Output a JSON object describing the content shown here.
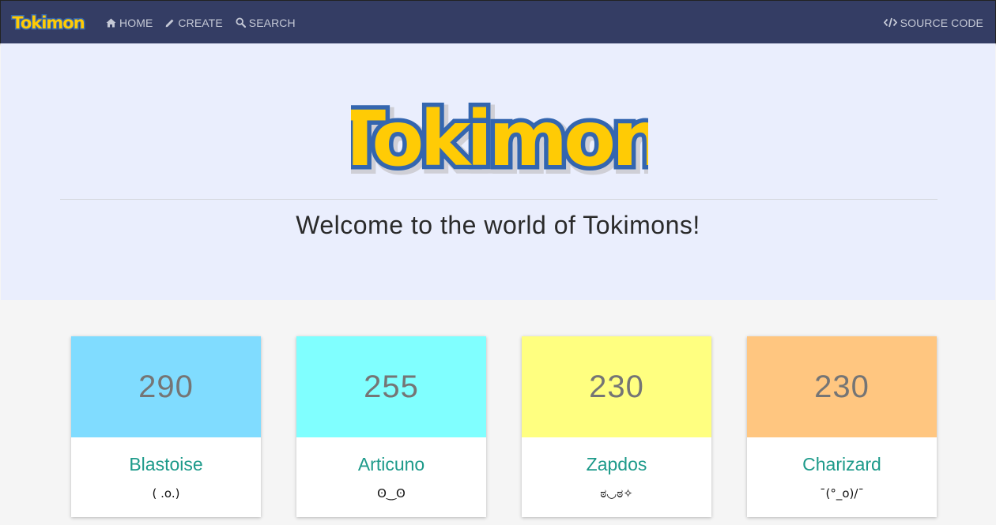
{
  "nav": {
    "logo_text": "Tokimon",
    "links": [
      {
        "label": "HOME",
        "icon": "home-icon"
      },
      {
        "label": "CREATE",
        "icon": "pencil-icon"
      },
      {
        "label": "SEARCH",
        "icon": "search-icon"
      }
    ],
    "source_code": {
      "label": "SOURCE CODE",
      "icon": "code-icon"
    }
  },
  "hero": {
    "logo_text": "Tokimon",
    "title": "Welcome to the world of Tokimons!"
  },
  "cards": [
    {
      "total": "290",
      "name": "Blastoise",
      "face": "( .o.)",
      "color": "#80dcff"
    },
    {
      "total": "255",
      "name": "Articuno",
      "face": "ʘ‿ʘ",
      "color": "#80ffff"
    },
    {
      "total": "230",
      "name": "Zapdos",
      "face": "ಠ◡ಠ✧",
      "color": "#ffff80"
    },
    {
      "total": "230",
      "name": "Charizard",
      "face": "¯(°_o)/¯",
      "color": "#ffc680"
    }
  ],
  "colors": {
    "navbar": "#343d64",
    "hero_bg": "#eaeefd",
    "logo_yellow": "#ffcb05",
    "logo_blue": "#3466af",
    "name_teal": "#1d9a8a"
  }
}
